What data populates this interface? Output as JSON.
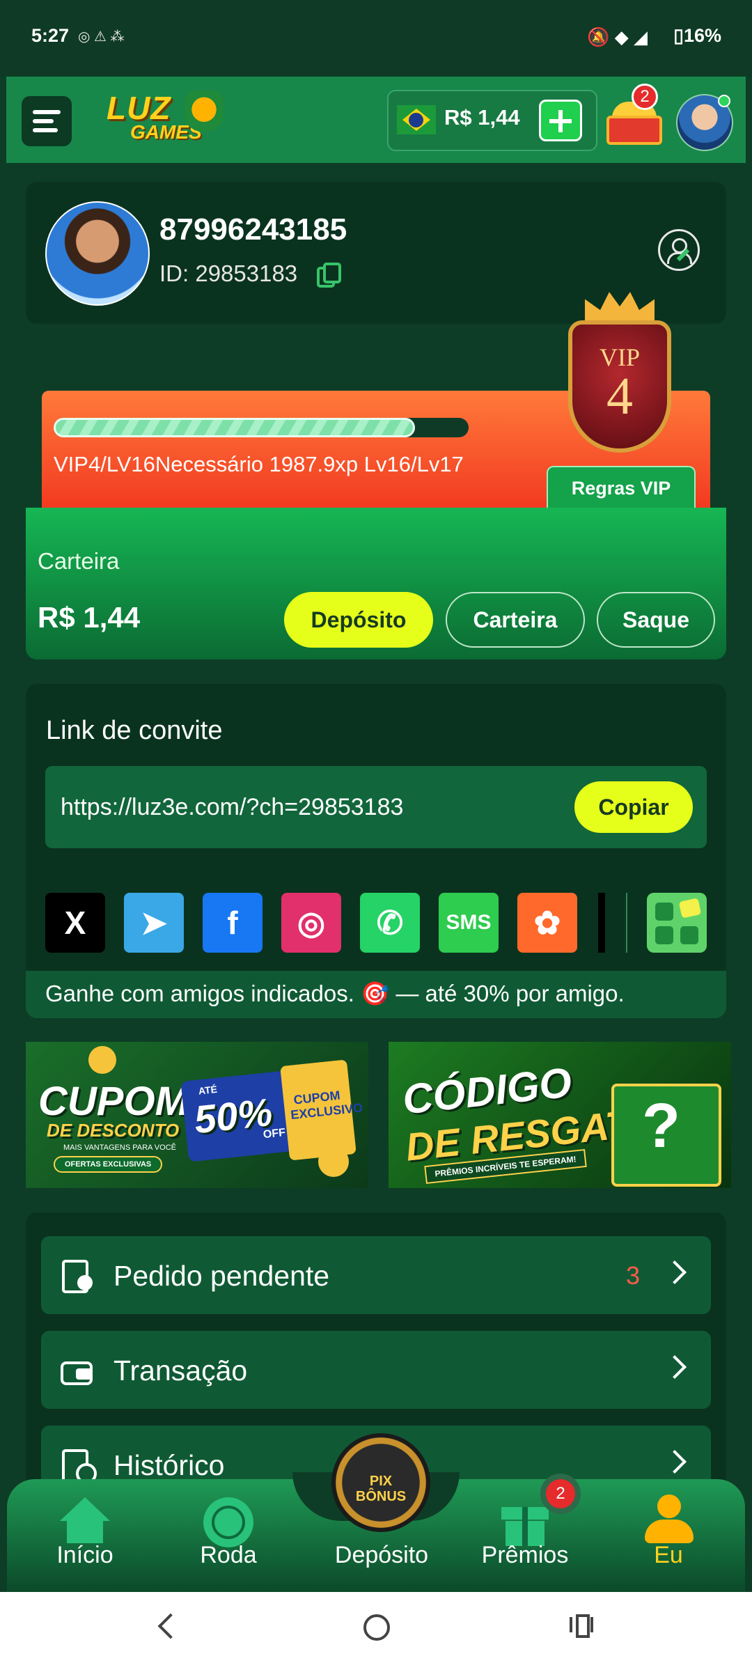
{
  "status_bar": {
    "time": "5:27",
    "icons_left": "◎ ⚠ ⁂",
    "battery": "16%"
  },
  "header": {
    "logo_line1": "LUZ",
    "logo_line2": "GAMES",
    "balance": "R$ 1,44",
    "rewards_badge": "2"
  },
  "profile": {
    "phone": "87996243185",
    "id_label": "ID: 29853183"
  },
  "vip": {
    "progress": 0.87,
    "text": "VIP4/LV16Necessário 1987.9xp Lv16/Lv17",
    "rules_label": "Regras VIP",
    "badge_top": "VIP",
    "badge_level": "4"
  },
  "wallet": {
    "title": "Carteira",
    "amount": "R$ 1,44",
    "deposit_label": "Depósito",
    "wallet_label": "Carteira",
    "withdraw_label": "Saque"
  },
  "invite": {
    "title": "Link de convite",
    "link": "https://luz3e.com/?ch=29853183",
    "copy_label": "Copiar",
    "share": [
      {
        "name": "x-icon",
        "glyph": "X",
        "bg": "#000000"
      },
      {
        "name": "telegram-icon",
        "glyph": "➤",
        "bg": "#3aa8e6"
      },
      {
        "name": "facebook-icon",
        "glyph": "f",
        "bg": "#1877f2"
      },
      {
        "name": "instagram-icon",
        "glyph": "◎",
        "bg": "#e1306c"
      },
      {
        "name": "whatsapp-icon",
        "glyph": "✆",
        "bg": "#25d366"
      },
      {
        "name": "sms-icon",
        "glyph": "SMS",
        "bg": "#2ecc4f"
      },
      {
        "name": "kwai-icon",
        "glyph": "✿",
        "bg": "#ff6a2c"
      }
    ],
    "earn_text": "Ganhe com amigos indicados. 🎯 — até 30% por amigo."
  },
  "banners": {
    "cupom_title": "CUPOM",
    "cupom_sub": "DE DESCONTO",
    "cupom_small": "MAIS VANTAGENS PARA VOCÊ",
    "cupom_offers": "OFERTAS EXCLUSIVAS",
    "cupom_ate": "ATÉ",
    "cupom_pct": "50%",
    "cupom_off": "OFF",
    "cupom_exc": "CUPOM EXCLUSIVO",
    "codigo_title": "CÓDIGO",
    "codigo_sub": "DE RESGATE",
    "codigo_small": "PRÊMIOS INCRÍVEIS TE ESPERAM!"
  },
  "menu": {
    "items": [
      {
        "label": "Pedido pendente",
        "count": "3"
      },
      {
        "label": "Transação",
        "count": ""
      },
      {
        "label": "Histórico",
        "count": ""
      }
    ]
  },
  "nav": {
    "items": [
      {
        "label": "Início"
      },
      {
        "label": "Roda"
      },
      {
        "label": "Depósito"
      },
      {
        "label": "Prêmios"
      },
      {
        "label": "Eu"
      }
    ],
    "prizes_badge": "2",
    "pix_line1": "PIX",
    "pix_line2": "BÔNUS",
    "active_color": "#ffd21e"
  }
}
